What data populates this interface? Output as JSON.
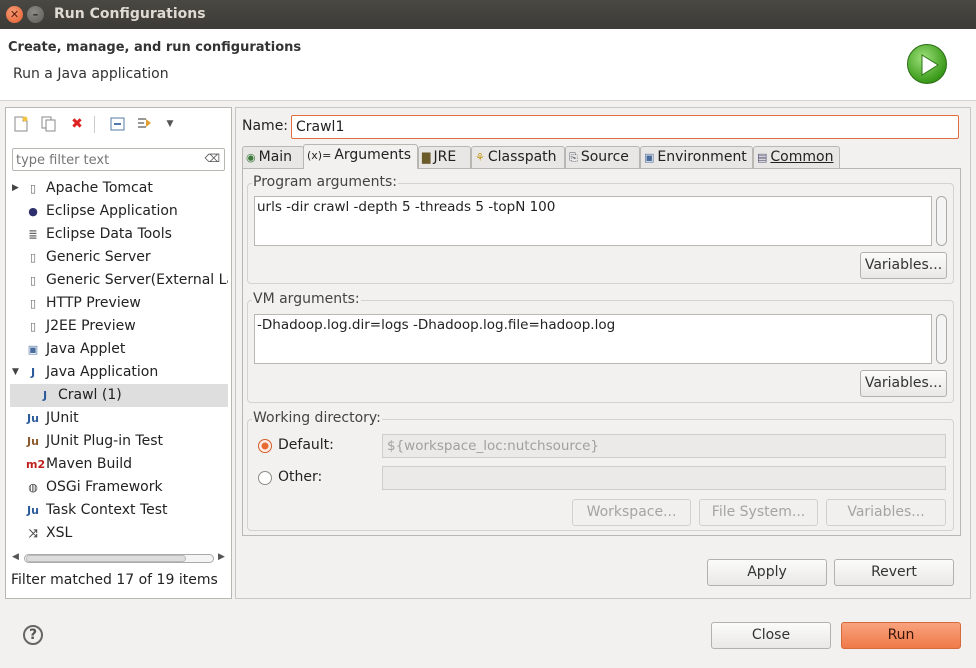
{
  "window": {
    "title": "Run Configurations"
  },
  "header": {
    "title": "Create, manage, and run configurations",
    "subtitle": "Run a Java application"
  },
  "left": {
    "filter_placeholder": "type filter text",
    "tree": [
      {
        "label": "Apache Tomcat",
        "icon": "tomcat-icon",
        "expandable": true
      },
      {
        "label": "Eclipse Application",
        "icon": "eclipse-icon"
      },
      {
        "label": "Eclipse Data Tools",
        "icon": "database-icon"
      },
      {
        "label": "Generic Server",
        "icon": "server-icon"
      },
      {
        "label": "Generic Server(External Lau",
        "icon": "server-icon"
      },
      {
        "label": "HTTP Preview",
        "icon": "server-icon"
      },
      {
        "label": "J2EE Preview",
        "icon": "server-icon"
      },
      {
        "label": "Java Applet",
        "icon": "applet-icon"
      },
      {
        "label": "Java Application",
        "icon": "java-app-icon",
        "expanded": true
      },
      {
        "label": "Crawl (1)",
        "icon": "java-app-icon",
        "child": true,
        "selected": true
      },
      {
        "label": "JUnit",
        "icon": "junit-icon"
      },
      {
        "label": "JUnit Plug-in Test",
        "icon": "junit-plugin-icon"
      },
      {
        "label": "Maven Build",
        "icon": "maven-icon"
      },
      {
        "label": "OSGi Framework",
        "icon": "osgi-icon"
      },
      {
        "label": "Task Context Test",
        "icon": "junit-icon"
      },
      {
        "label": "XSL",
        "icon": "xsl-icon"
      }
    ],
    "status": "Filter matched 17 of 19 items"
  },
  "right": {
    "name_label": "Name:",
    "name_value": "Crawl1",
    "tabs": [
      "Main",
      "Arguments",
      "JRE",
      "Classpath",
      "Source",
      "Environment",
      "Common"
    ],
    "active_tab": "Arguments",
    "program_args_label": "Program arguments:",
    "program_args": "urls -dir crawl -depth 5 -threads 5 -topN 100",
    "vm_args_label": "VM arguments:",
    "vm_args": "-Dhadoop.log.dir=logs -Dhadoop.log.file=hadoop.log",
    "variables_label": "Variables...",
    "workdir_label": "Working directory:",
    "default_label": "Default:",
    "default_value": "${workspace_loc:nutchsource}",
    "other_label": "Other:",
    "workspace_btn": "Workspace...",
    "filesystem_btn": "File System...",
    "apply_btn": "Apply",
    "revert_btn": "Revert"
  },
  "footer": {
    "close_btn": "Close",
    "run_btn": "Run"
  },
  "colors": {
    "accent": "#e86a33",
    "titlebar": "#3c3b37"
  }
}
